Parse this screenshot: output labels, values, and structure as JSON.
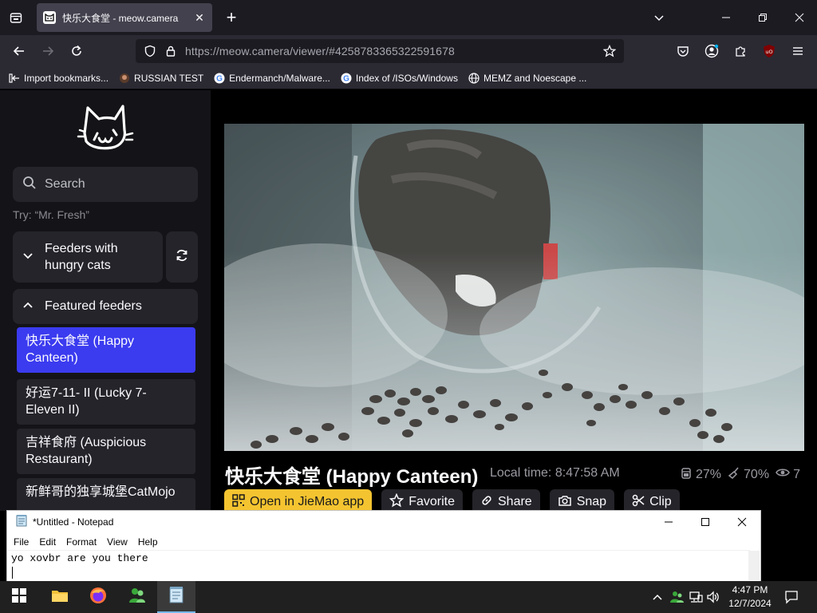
{
  "browser": {
    "tab_title": "快乐大食堂 - meow.camera",
    "url_host": "https://meow.camera",
    "url_path": "/viewer/#4258783365322591678",
    "bookmarks": [
      {
        "label": "Import bookmarks...",
        "icon": "import-icon"
      },
      {
        "label": "RUSSIAN TEST",
        "icon": "site-favicon"
      },
      {
        "label": "Endermanch/Malware...",
        "icon": "google-favicon"
      },
      {
        "label": "Index of /ISOs/Windows",
        "icon": "google-favicon"
      },
      {
        "label": "MEMZ and Noescape ...",
        "icon": "globe-icon"
      }
    ]
  },
  "sidebar": {
    "search_placeholder": "Search",
    "hint": "Try: “Mr. Fresh”",
    "feeder_group_label_line1": "Feeders with",
    "feeder_group_label_line2": "hungry cats",
    "featured_label": "Featured feeders",
    "feeders": [
      {
        "line1": "快乐大食堂 (Happy",
        "line2": "Canteen)",
        "active": true
      },
      {
        "line1": "好运7-11- II  (Lucky 7-",
        "line2": "Eleven II)",
        "active": false
      },
      {
        "line1": "吉祥食府 (Auspicious",
        "line2": "Restaurant)",
        "active": false
      },
      {
        "line1": "新鲜哥的独享城堡CatMojo",
        "line2": "",
        "active": false
      }
    ]
  },
  "camera": {
    "title": "快乐大食堂 (Happy Canteen)",
    "local_time": "Local time: 8:47:58 AM",
    "food_level": "27%",
    "cleanliness": "70%",
    "viewers": "7"
  },
  "actions": {
    "open_app": "Open in JieMao app",
    "favorite": "Favorite",
    "share": "Share",
    "snap": "Snap",
    "clip": "Clip"
  },
  "notepad": {
    "title": "*Untitled - Notepad",
    "menu": [
      "File",
      "Edit",
      "Format",
      "View",
      "Help"
    ],
    "content": "yo xovbr are you there"
  },
  "taskbar": {
    "time": "4:47 PM",
    "date": "12/7/2024"
  },
  "colors": {
    "accent_blue": "#3b3bf0",
    "button_yellow": "#f4c430",
    "sidebar_bg": "#141418",
    "surface": "#24242a"
  }
}
